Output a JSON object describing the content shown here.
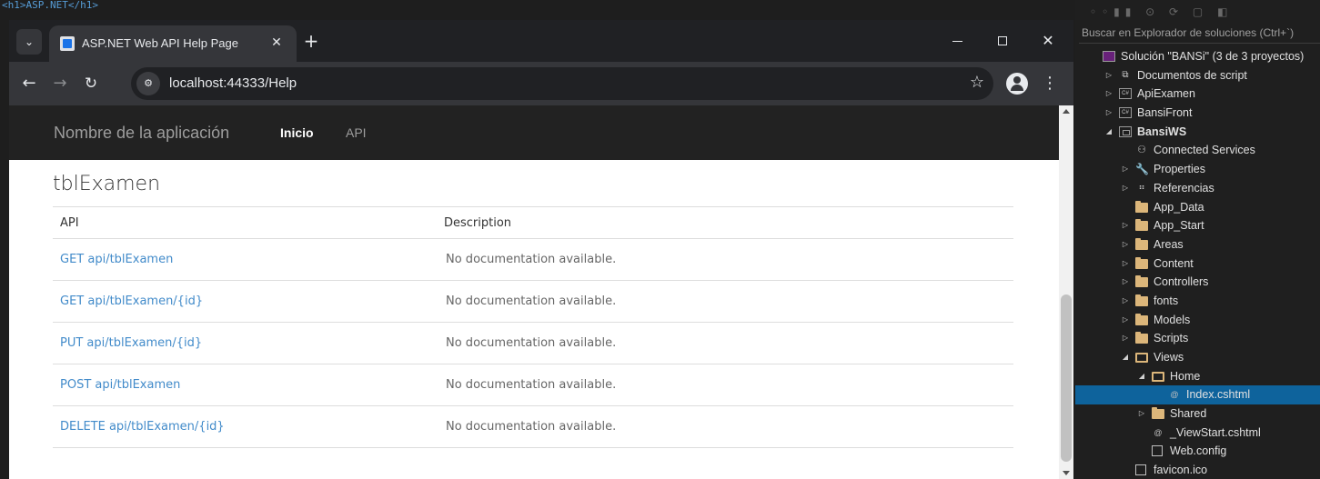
{
  "vs_editor": {
    "code_snippet": "<h1>ASP.NET</h1>"
  },
  "chrome": {
    "tab": {
      "title": "ASP.NET Web API Help Page",
      "close": "✕"
    },
    "new_tab": "+",
    "window_controls": {
      "minimize": "",
      "maximize": "",
      "close": "✕"
    },
    "nav": {
      "back": "←",
      "forward": "→",
      "reload": "↻"
    },
    "url": "localhost:44333/Help",
    "site_info_icon": "tune-icon",
    "star": "☆",
    "menu": "⋮"
  },
  "page": {
    "navbar": {
      "brand": "Nombre de la aplicación",
      "links": [
        "Inicio",
        "API"
      ]
    },
    "controller": "tblExamen",
    "table": {
      "headers": [
        "API",
        "Description"
      ],
      "rows": [
        {
          "api": "GET api/tblExamen",
          "description": "No documentation available."
        },
        {
          "api": "GET api/tblExamen/{id}",
          "description": "No documentation available."
        },
        {
          "api": "PUT api/tblExamen/{id}",
          "description": "No documentation available."
        },
        {
          "api": "POST api/tblExamen",
          "description": "No documentation available."
        },
        {
          "api": "DELETE api/tblExamen/{id}",
          "description": "No documentation available."
        }
      ]
    }
  },
  "solution_explorer": {
    "search_placeholder": "Buscar en Explorador de soluciones (Ctrl+`)",
    "items": [
      {
        "label": "Solución \"BANSi\" (3 de 3 proyectos)",
        "indent": 0,
        "arrow": "",
        "icon": "sln",
        "bold": false
      },
      {
        "label": "Documentos de script",
        "indent": 1,
        "arrow": "▷",
        "icon": "script",
        "bold": false
      },
      {
        "label": "ApiExamen",
        "indent": 1,
        "arrow": "▷",
        "icon": "cs",
        "bold": false
      },
      {
        "label": "BansiFront",
        "indent": 1,
        "arrow": "▷",
        "icon": "cs",
        "bold": false
      },
      {
        "label": "BansiWS",
        "indent": 1,
        "arrow": "◢",
        "icon": "web",
        "bold": true
      },
      {
        "label": "Connected Services",
        "indent": 2,
        "arrow": "",
        "icon": "plug",
        "bold": false
      },
      {
        "label": "Properties",
        "indent": 2,
        "arrow": "▷",
        "icon": "wrench",
        "bold": false
      },
      {
        "label": "Referencias",
        "indent": 2,
        "arrow": "▷",
        "icon": "refs",
        "bold": false
      },
      {
        "label": "App_Data",
        "indent": 2,
        "arrow": "",
        "icon": "folder",
        "bold": false
      },
      {
        "label": "App_Start",
        "indent": 2,
        "arrow": "▷",
        "icon": "folder",
        "bold": false
      },
      {
        "label": "Areas",
        "indent": 2,
        "arrow": "▷",
        "icon": "folder",
        "bold": false
      },
      {
        "label": "Content",
        "indent": 2,
        "arrow": "▷",
        "icon": "folder",
        "bold": false
      },
      {
        "label": "Controllers",
        "indent": 2,
        "arrow": "▷",
        "icon": "folder",
        "bold": false
      },
      {
        "label": "fonts",
        "indent": 2,
        "arrow": "▷",
        "icon": "folder",
        "bold": false
      },
      {
        "label": "Models",
        "indent": 2,
        "arrow": "▷",
        "icon": "folder",
        "bold": false
      },
      {
        "label": "Scripts",
        "indent": 2,
        "arrow": "▷",
        "icon": "folder",
        "bold": false
      },
      {
        "label": "Views",
        "indent": 2,
        "arrow": "◢",
        "icon": "folder-open",
        "bold": false
      },
      {
        "label": "Home",
        "indent": 3,
        "arrow": "◢",
        "icon": "folder-open",
        "bold": false
      },
      {
        "label": "Index.cshtml",
        "indent": 4,
        "arrow": "",
        "icon": "razor",
        "bold": false,
        "selected": true
      },
      {
        "label": "Shared",
        "indent": 3,
        "arrow": "▷",
        "icon": "folder",
        "bold": false
      },
      {
        "label": "_ViewStart.cshtml",
        "indent": 3,
        "arrow": "",
        "icon": "razor",
        "bold": false
      },
      {
        "label": "Web.config",
        "indent": 3,
        "arrow": "",
        "icon": "doc",
        "bold": false
      },
      {
        "label": "favicon.ico",
        "indent": 2,
        "arrow": "",
        "icon": "doc",
        "bold": false
      }
    ]
  }
}
